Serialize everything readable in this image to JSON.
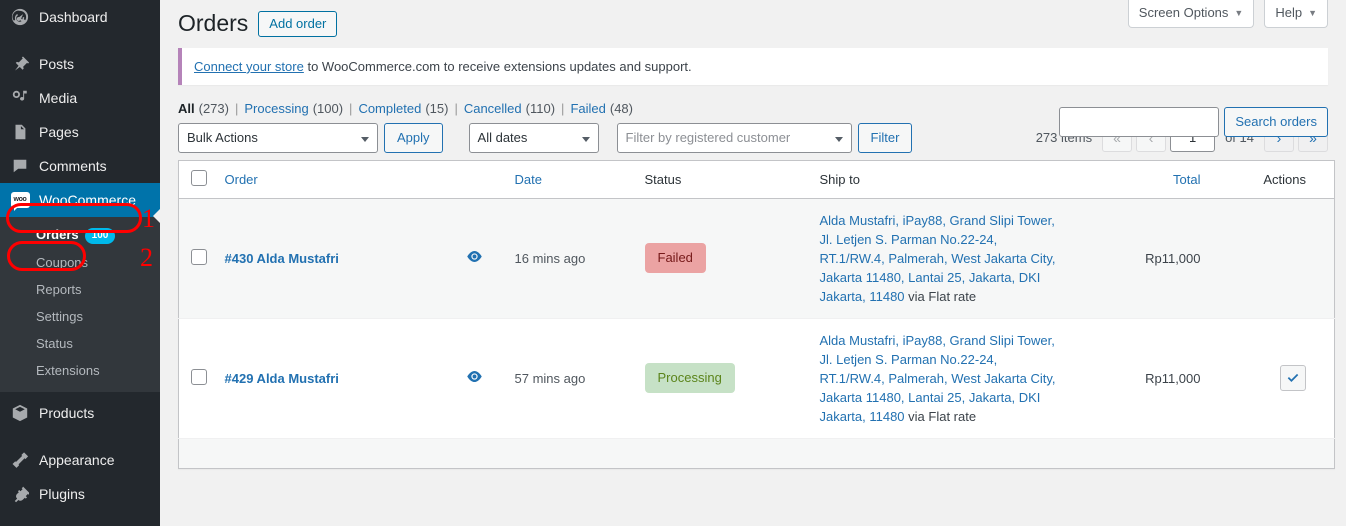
{
  "sidebar": {
    "items": [
      {
        "label": "Dashboard",
        "icon": "dashboard-icon",
        "name": "dashboard"
      },
      {
        "label": "Posts",
        "icon": "pin-icon",
        "name": "posts"
      },
      {
        "label": "Media",
        "icon": "media-icon",
        "name": "media"
      },
      {
        "label": "Pages",
        "icon": "pages-icon",
        "name": "pages"
      },
      {
        "label": "Comments",
        "icon": "comments-icon",
        "name": "comments"
      },
      {
        "label": "WooCommerce",
        "icon": "woocommerce-icon",
        "name": "woocommerce",
        "current": true
      },
      {
        "label": "Products",
        "icon": "products-icon",
        "name": "products"
      },
      {
        "label": "Appearance",
        "icon": "appearance-icon",
        "name": "appearance"
      },
      {
        "label": "Plugins",
        "icon": "plugins-icon",
        "name": "plugins"
      }
    ],
    "submenu": [
      {
        "label": "Orders",
        "badge": "100",
        "current": true
      },
      {
        "label": "Coupons",
        "badge": ""
      },
      {
        "label": "Reports",
        "badge": ""
      },
      {
        "label": "Settings",
        "badge": ""
      },
      {
        "label": "Status",
        "badge": ""
      },
      {
        "label": "Extensions",
        "badge": ""
      }
    ]
  },
  "screen_meta": {
    "screen_options": "Screen Options",
    "help": "Help",
    "caret": "▼"
  },
  "header": {
    "title": "Orders",
    "add_order": "Add order"
  },
  "notice": {
    "link_text": "Connect your store",
    "rest_text": " to WooCommerce.com to receive extensions updates and support."
  },
  "status_filters": [
    {
      "label": "All",
      "count": "(273)",
      "current": true
    },
    {
      "label": "Processing",
      "count": "(100)",
      "current": false
    },
    {
      "label": "Completed",
      "count": "(15)",
      "current": false
    },
    {
      "label": "Cancelled",
      "count": "(110)",
      "current": false
    },
    {
      "label": "Failed",
      "count": "(48)",
      "current": false
    }
  ],
  "search": {
    "value": "",
    "placeholder": "",
    "button": "Search orders"
  },
  "toolbar": {
    "bulk_actions": "Bulk Actions",
    "apply": "Apply",
    "all_dates": "All dates",
    "customer_filter": "Filter by registered customer",
    "filter": "Filter"
  },
  "pagination": {
    "items": "273 items",
    "first": "«",
    "prev": "‹",
    "current_page": "1",
    "of_total": "of 14",
    "next": "›",
    "last": "»"
  },
  "table": {
    "columns": [
      {
        "label": "",
        "name": "select-all",
        "sortable": false
      },
      {
        "label": "Order",
        "name": "order",
        "sortable": true
      },
      {
        "label": "",
        "name": "preview",
        "sortable": false
      },
      {
        "label": "Date",
        "name": "date",
        "sortable": true
      },
      {
        "label": "Status",
        "name": "status",
        "sortable": false
      },
      {
        "label": "Ship to",
        "name": "ship-to",
        "sortable": false
      },
      {
        "label": "Total",
        "name": "total",
        "sortable": true
      },
      {
        "label": "Actions",
        "name": "actions",
        "sortable": false
      }
    ],
    "rows": [
      {
        "order": "#430 Alda Mustafri",
        "date": "16 mins ago",
        "status": "Failed",
        "status_type": "failed",
        "ship_to": "Alda Mustafri, iPay88, Grand Slipi Tower, Jl. Letjen S. Parman No.22-24, RT.1/RW.4, Palmerah, West Jakarta City, Jakarta 11480, Lantai 25, Jakarta, DKI Jakarta, 11480",
        "via": "via Flat rate",
        "total": "Rp11,000",
        "has_action": false
      },
      {
        "order": "#429 Alda Mustafri",
        "date": "57 mins ago",
        "status": "Processing",
        "status_type": "processing",
        "ship_to": "Alda Mustafri, iPay88, Grand Slipi Tower, Jl. Letjen S. Parman No.22-24, RT.1/RW.4, Palmerah, West Jakarta City, Jakarta 11480, Lantai 25, Jakarta, DKI Jakarta, 11480",
        "via": "via Flat rate",
        "total": "Rp11,000",
        "has_action": true
      }
    ]
  },
  "annotations": [
    {
      "number": "1",
      "target": "woocommerce-menu-item"
    },
    {
      "number": "2",
      "target": "orders-submenu-item"
    }
  ],
  "colors": {
    "sidebar_bg": "#23282d",
    "submenu_bg": "#32373c",
    "current_blue": "#0073aa",
    "link_blue": "#2271b1",
    "badge_blue": "#00b9eb",
    "status_failed_bg": "#eba3a3",
    "status_processing_bg": "#c6e1c6",
    "notice_border": "#b583b9",
    "annotation_red": "#ff0000"
  }
}
